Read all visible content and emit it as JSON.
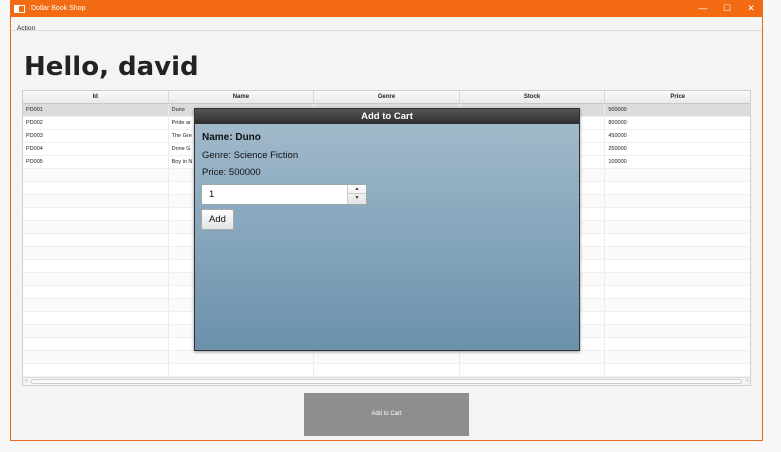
{
  "window": {
    "title": "Dollar Book Shop",
    "controls": {
      "minimize": "—",
      "maximize": "☐",
      "close": "✕"
    }
  },
  "menu": {
    "items": [
      "Action"
    ]
  },
  "greeting": "Hello, david",
  "table": {
    "columns": [
      "Id",
      "Name",
      "Genre",
      "Stock",
      "Price"
    ],
    "rows": [
      [
        "PD001",
        "Duno",
        "",
        "",
        "500000"
      ],
      [
        "PD002",
        "Pride ar",
        "",
        "",
        "800000"
      ],
      [
        "PD003",
        "The Gre",
        "",
        "",
        "450000"
      ],
      [
        "PD004",
        "Done G",
        "",
        "",
        "250000"
      ],
      [
        "PD005",
        "Boy in N",
        "",
        "",
        "100000"
      ]
    ],
    "selected_row": 0,
    "empty_rows": 16,
    "scroll_left": "‹",
    "scroll_right": "›"
  },
  "modal": {
    "title": "Add to Cart",
    "name_line": "Name: Duno",
    "genre_line": "Genre: Science Fiction",
    "price_line": "Price: 500000",
    "quantity_value": "1",
    "spin_up": "▲",
    "spin_down": "▼",
    "add_label": "Add"
  },
  "add_to_cart_button": "Add to Cart",
  "colors": {
    "titlebar": "#f26a12",
    "modal_top": "#a4bccd",
    "modal_bottom": "#6b91ab",
    "button_gray": "#8e8e8e"
  }
}
